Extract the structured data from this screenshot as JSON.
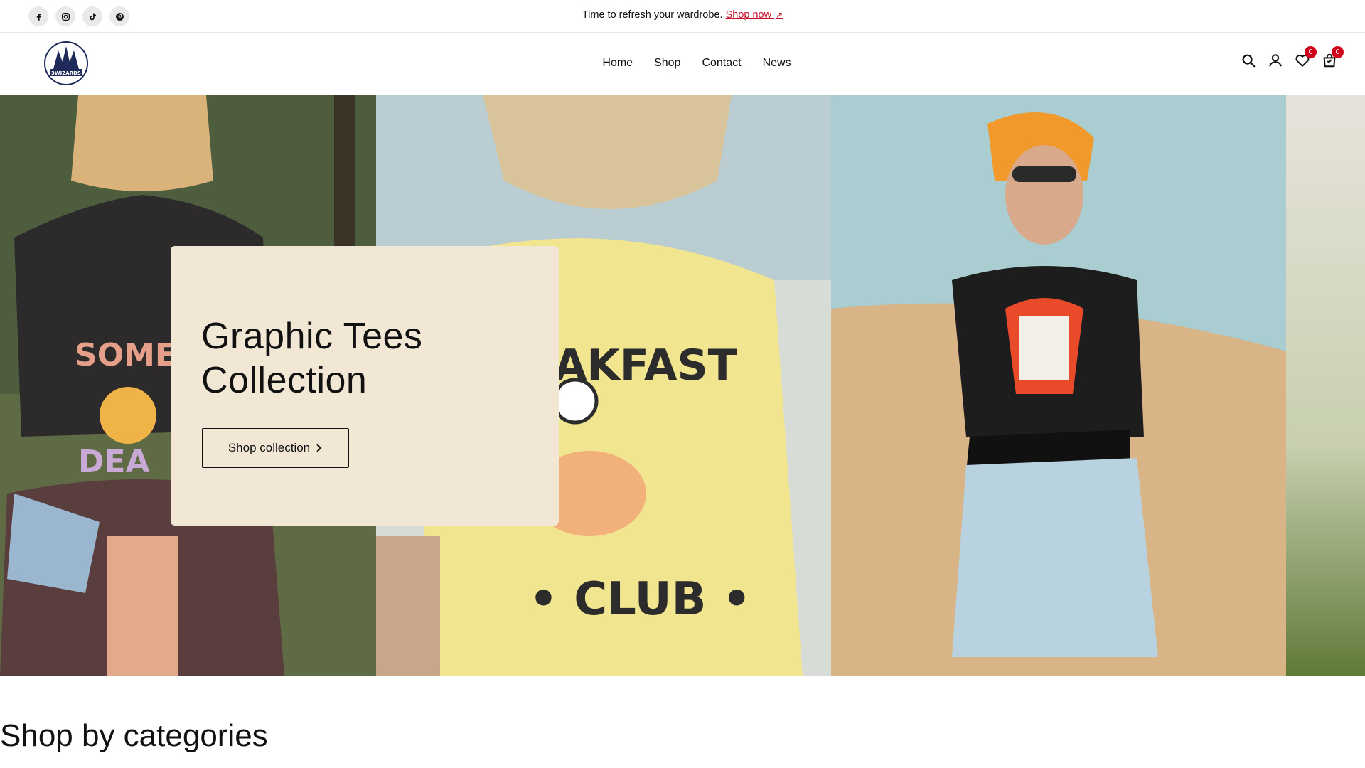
{
  "topbar": {
    "socials": [
      "facebook-icon",
      "instagram-icon",
      "tiktok-icon",
      "pinterest-icon"
    ],
    "announcement": "Time to refresh your wardrobe.",
    "link_label": "Shop now",
    "link_arrow": "↗",
    "link_color": "#c8102e"
  },
  "header": {
    "logo_text": "3WIZARDS",
    "nav": [
      "Home",
      "Shop",
      "Contact",
      "News"
    ],
    "wishlist_count": "0",
    "cart_count": "0",
    "badge_color": "#d0021b"
  },
  "hero": {
    "title_line1": "Graphic Tees",
    "title_line2": "Collection",
    "button_label": "Shop collection",
    "card_color": "#f1e7d4"
  },
  "sections": {
    "categories_title": "Shop by categories"
  }
}
